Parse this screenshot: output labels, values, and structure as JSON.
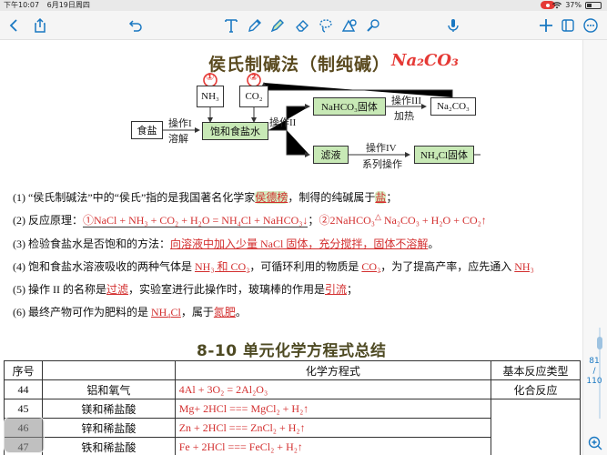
{
  "status_bar": {
    "time": "下午10:07",
    "date": "6月19日周四",
    "battery_percent": "37%",
    "battery_level": 0.37,
    "wifi_icon": "wifi-icon"
  },
  "toolbar": {
    "icons": [
      "back-chevron-icon",
      "share-icon",
      "undo-icon",
      "text-tool-icon",
      "pen-icon",
      "highlighter-icon",
      "eraser-icon",
      "lasso-icon",
      "shapes-icon",
      "paint-icon",
      "microphone-icon",
      "add-icon",
      "page-view-icon",
      "more-icon"
    ]
  },
  "worksheet": {
    "title": "侯氏制碱法（制纯碱）",
    "title_handwritten": "Na₂CO₃",
    "annot1": "①",
    "annot2": "②",
    "flow": {
      "food_salt": "食盐",
      "nh3": "NH₃",
      "co2": "CO₂",
      "saturated": "饱和食盐水",
      "nahco3": "NaHCO₃固体",
      "na2co3": "Na₂CO₃",
      "filtrate": "滤液",
      "nh4cl": "NH₄Cl固体",
      "op1": "操作I",
      "dissolve": "溶解",
      "op2": "操作II",
      "op3": "操作III",
      "heat": "加热",
      "op4": "操作IV",
      "series": "系列操作"
    },
    "q1": {
      "pre": "(1)  “侯氏制碱法”中的“侯氏”指的是我国著名化学家",
      "a1": "侯德榜",
      "mid": "，制得的纯碱属于",
      "a2": "盐",
      "post": "；"
    },
    "q2": {
      "pre": "(2)  反应原理：",
      "r1": "①NaCl + NH₃ + CO₂ + H₂O = NH₄Cl + NaHCO₃↓",
      "sep": "；",
      "r2a": "②2NaHCO₃",
      "r2b": "△",
      "r2c": " Na₂CO₃ + H₂O + CO₂↑"
    },
    "q3": {
      "pre": "(3)  检验食盐水是否饱和的方法：",
      "a": "向溶液中加入少量 NaCl 固体，充分搅拌，固体不溶解",
      "post": "。"
    },
    "q4": {
      "pre": "(4)  饱和食盐水溶液吸收的两种气体是 ",
      "a1": "NH₃ 和 CO₂",
      "mid": "，可循环利用的物质是 ",
      "a2": "CO₂",
      "mid2": "，为了提高产率，应先通入 ",
      "a3": "NH₃"
    },
    "q5": {
      "pre": "(5)  操作 II 的名称是",
      "a1": "过滤",
      "mid": "，实验室进行此操作时，玻璃棒的作用是",
      "a2": "引流",
      "post": "；"
    },
    "q6": {
      "pre": "(6)  最终产物可作为肥料的是 ",
      "a1": "NH₄Cl",
      "mid": "，属于",
      "a2": "氮肥",
      "post": "。"
    }
  },
  "section_title": "8-10 单元化学方程式总结",
  "table": {
    "headers": [
      "序号",
      "",
      "化学方程式",
      "基本反应类型"
    ],
    "rows": [
      {
        "no": "44",
        "name": "铝和氧气",
        "eq": "4Al + 3O₂ = 2Al₂O₃",
        "type": "化合反应"
      },
      {
        "no": "45",
        "name": "镁和稀盐酸",
        "eq": "Mg+ 2HCl === MgCl₂ + H₂↑",
        "type": ""
      },
      {
        "no": "46",
        "name": "锌和稀盐酸",
        "eq": "Zn + 2HCl === ZnCl₂ + H₂↑",
        "type": ""
      },
      {
        "no": "47",
        "name": "铁和稀盐酸",
        "eq": "Fe + 2HCl === FeCl₂ + H₂↑",
        "type": ""
      }
    ]
  },
  "sidebar": {
    "page_current": "81",
    "page_sep": "/",
    "page_total": "110"
  },
  "colors": {
    "accent": "#1a78c2",
    "answer_red": "#d32f2f",
    "highlight_green": "#c8e9b6"
  }
}
